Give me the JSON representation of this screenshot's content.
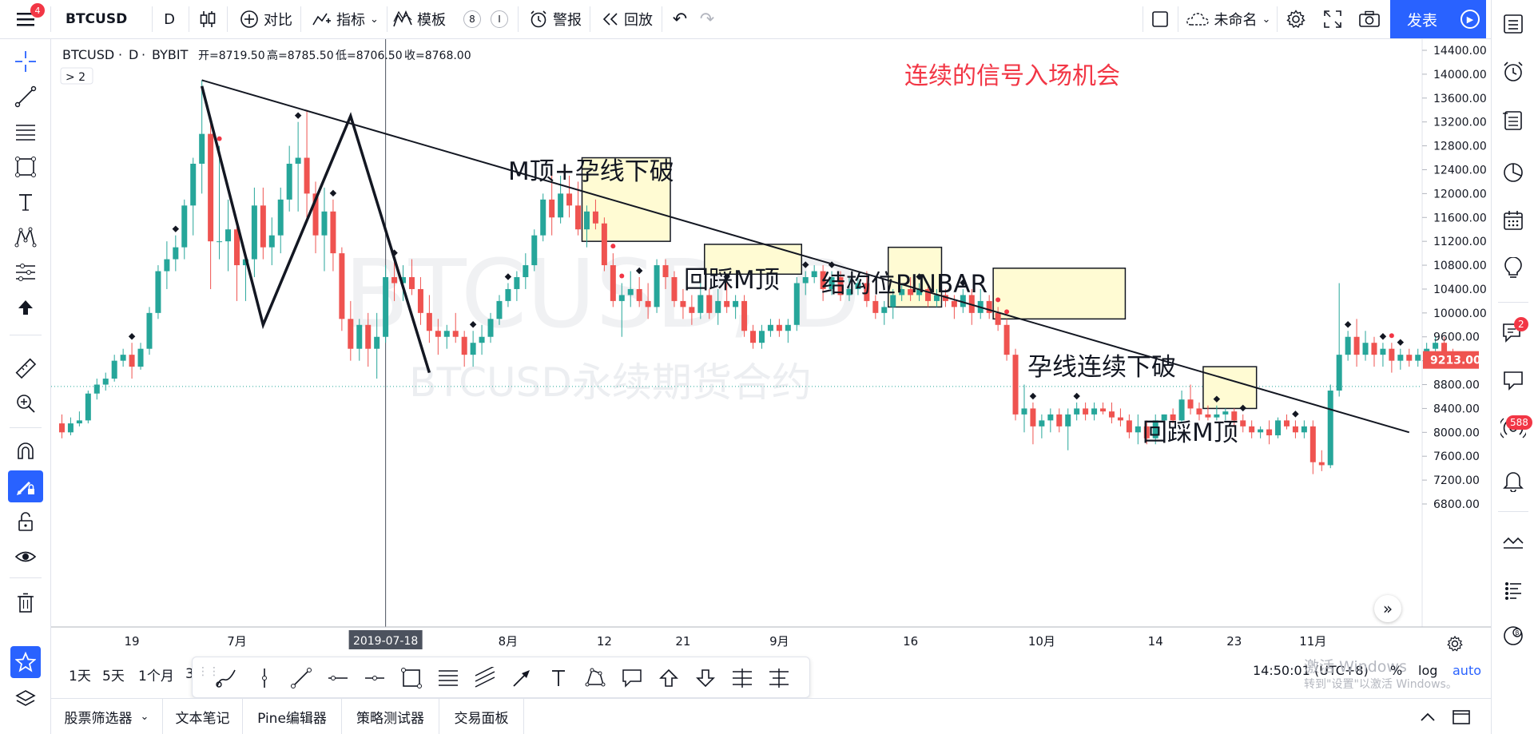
{
  "topbar": {
    "menu_badge": "4",
    "symbol": "BTCUSD",
    "interval": "D",
    "compare_label": "对比",
    "indicators_label": "指标",
    "templates_label": "模板",
    "template_chip_a": "8",
    "template_chip_b": "I",
    "alert_label": "警报",
    "replay_label": "回放",
    "layout_name": "未命名",
    "publish_label": "发表"
  },
  "legend": {
    "symbol": "BTCUSD",
    "interval": "D",
    "exchange": "BYBIT",
    "open": "开=8719.50",
    "high": "高=8785.50",
    "low": "低=8706.50",
    "close": "收=8768.00",
    "collapse": "> 2"
  },
  "watermark": {
    "line1": "BTCUSD, D",
    "line2": "BTCUSD永续期货合约"
  },
  "annotations": {
    "title": "连续的信号入场机会",
    "m_top_break": "M顶+孕线下破",
    "retest_m_top_1": "回踩M顶",
    "pinbar": "结构位PINBAR",
    "inside_bar_break": "孕线连续下破",
    "retest_m_top_2": "回踩M顶"
  },
  "chart_data": {
    "type": "candlestick",
    "title": "",
    "symbol": "BTCUSD",
    "interval": "D",
    "ylim": [
      6600,
      14800
    ],
    "y_ticks": [
      "14400.00",
      "14000.00",
      "13600.00",
      "13200.00",
      "12800.00",
      "12400.00",
      "12000.00",
      "11600.00",
      "11200.00",
      "10800.00",
      "10400.00",
      "10000.00",
      "9600.00",
      "9200.00",
      "8800.00",
      "8400.00",
      "8000.00",
      "7600.00",
      "7200.00",
      "6800.00"
    ],
    "x_ticks": [
      {
        "label": "19",
        "bar": 8
      },
      {
        "label": "7月",
        "bar": 20
      },
      {
        "label": "2019-07-18",
        "bar": 37,
        "highlight": true
      },
      {
        "label": "8月",
        "bar": 51
      },
      {
        "label": "12",
        "bar": 62
      },
      {
        "label": "21",
        "bar": 71
      },
      {
        "label": "9月",
        "bar": 82
      },
      {
        "label": "16",
        "bar": 97
      },
      {
        "label": "10月",
        "bar": 112
      },
      {
        "label": "14",
        "bar": 125
      },
      {
        "label": "23",
        "bar": 134
      },
      {
        "label": "11月",
        "bar": 143
      }
    ],
    "last_price": "9213.00",
    "dotted_price_line": 8768,
    "crosshair_bar": 37,
    "candles": [
      [
        8150,
        8300,
        7900,
        8000
      ],
      [
        8000,
        8250,
        7950,
        8150
      ],
      [
        8150,
        8350,
        8100,
        8200
      ],
      [
        8200,
        8700,
        8150,
        8650
      ],
      [
        8650,
        8900,
        8550,
        8800
      ],
      [
        8800,
        9000,
        8700,
        8900
      ],
      [
        8900,
        9300,
        8850,
        9200
      ],
      [
        9200,
        9400,
        9100,
        9300
      ],
      [
        9300,
        9500,
        8900,
        9100
      ],
      [
        9100,
        9500,
        9050,
        9400
      ],
      [
        9400,
        10100,
        9300,
        10000
      ],
      [
        10000,
        10800,
        9900,
        10700
      ],
      [
        10700,
        11200,
        10400,
        10900
      ],
      [
        10900,
        11300,
        10700,
        11100
      ],
      [
        11100,
        11900,
        10900,
        11800
      ],
      [
        11800,
        12600,
        11300,
        12500
      ],
      [
        12500,
        13900,
        12000,
        13000
      ],
      [
        13000,
        13200,
        10400,
        11200
      ],
      [
        11200,
        12800,
        10900,
        11200
      ],
      [
        11200,
        11900,
        10700,
        11400
      ],
      [
        11400,
        11500,
        10200,
        10800
      ],
      [
        10800,
        11000,
        10200,
        10900
      ],
      [
        10900,
        12100,
        10600,
        11800
      ],
      [
        11800,
        12100,
        10900,
        11100
      ],
      [
        11100,
        11600,
        10800,
        11300
      ],
      [
        11300,
        12100,
        11000,
        11900
      ],
      [
        11900,
        12800,
        11700,
        12500
      ],
      [
        12500,
        13200,
        11700,
        12600
      ],
      [
        12600,
        13400,
        11600,
        12000
      ],
      [
        12000,
        12200,
        11000,
        11300
      ],
      [
        11300,
        12100,
        10700,
        11700
      ],
      [
        11700,
        11900,
        10700,
        11000
      ],
      [
        11000,
        11100,
        9700,
        9900
      ],
      [
        9900,
        10200,
        9200,
        9400
      ],
      [
        9400,
        9900,
        9200,
        9800
      ],
      [
        9800,
        10000,
        9100,
        9400
      ],
      [
        9400,
        10000,
        8900,
        9600
      ],
      [
        9600,
        10800,
        9500,
        10600
      ],
      [
        10600,
        10900,
        10200,
        10500
      ],
      [
        10500,
        10800,
        10200,
        10600
      ],
      [
        10600,
        10900,
        10300,
        10400
      ],
      [
        10400,
        10600,
        9800,
        10000
      ],
      [
        10000,
        10300,
        9500,
        9700
      ],
      [
        9700,
        9900,
        9300,
        9600
      ],
      [
        9600,
        9800,
        9400,
        9700
      ],
      [
        9700,
        10000,
        9500,
        9600
      ],
      [
        9600,
        9700,
        9100,
        9300
      ],
      [
        9300,
        9700,
        9100,
        9500
      ],
      [
        9500,
        9800,
        9300,
        9600
      ],
      [
        9600,
        10000,
        9500,
        9900
      ],
      [
        9900,
        10300,
        9800,
        10200
      ],
      [
        10200,
        10500,
        10100,
        10400
      ],
      [
        10400,
        10700,
        10200,
        10600
      ],
      [
        10600,
        11000,
        10400,
        10800
      ],
      [
        10800,
        11400,
        10700,
        11300
      ],
      [
        11300,
        12000,
        11200,
        11900
      ],
      [
        11900,
        12400,
        11300,
        11600
      ],
      [
        11600,
        12300,
        11500,
        12000
      ],
      [
        12000,
        12300,
        11600,
        11800
      ],
      [
        11800,
        12200,
        11300,
        11400
      ],
      [
        11400,
        11800,
        11100,
        11700
      ],
      [
        11700,
        11900,
        11400,
        11500
      ],
      [
        11500,
        11600,
        10700,
        10800
      ],
      [
        10800,
        11000,
        10100,
        10200
      ],
      [
        10200,
        10500,
        9600,
        10300
      ],
      [
        10300,
        10700,
        10100,
        10400
      ],
      [
        10400,
        10600,
        10100,
        10200
      ],
      [
        10200,
        10500,
        9900,
        10100
      ],
      [
        10100,
        10900,
        10000,
        10800
      ],
      [
        10800,
        10900,
        10400,
        10600
      ],
      [
        10600,
        10700,
        10100,
        10200
      ],
      [
        10200,
        10400,
        9900,
        10100
      ],
      [
        10100,
        10300,
        9800,
        10000
      ],
      [
        10000,
        10500,
        9900,
        10300
      ],
      [
        10300,
        10400,
        9900,
        10000
      ],
      [
        10000,
        10400,
        9800,
        10200
      ],
      [
        10200,
        10500,
        10000,
        10100
      ],
      [
        10100,
        10300,
        9900,
        10200
      ],
      [
        10200,
        10300,
        9600,
        9700
      ],
      [
        9700,
        9800,
        9400,
        9500
      ],
      [
        9500,
        9800,
        9400,
        9700
      ],
      [
        9700,
        9900,
        9600,
        9800
      ],
      [
        9800,
        9900,
        9600,
        9700
      ],
      [
        9700,
        9900,
        9500,
        9800
      ],
      [
        9800,
        10600,
        9700,
        10500
      ],
      [
        10500,
        10700,
        10300,
        10600
      ],
      [
        10600,
        10800,
        10500,
        10700
      ],
      [
        10700,
        10800,
        10200,
        10400
      ],
      [
        10400,
        10700,
        10300,
        10600
      ],
      [
        10600,
        10700,
        10200,
        10300
      ],
      [
        10300,
        10600,
        10200,
        10400
      ],
      [
        10400,
        10600,
        10300,
        10500
      ],
      [
        10500,
        10700,
        10100,
        10200
      ],
      [
        10200,
        10300,
        9900,
        10000
      ],
      [
        10000,
        10200,
        9800,
        10100
      ],
      [
        10100,
        10400,
        9900,
        10300
      ],
      [
        10300,
        10500,
        10200,
        10400
      ],
      [
        10400,
        10600,
        10200,
        10300
      ],
      [
        10300,
        10500,
        10200,
        10400
      ],
      [
        10400,
        10500,
        10100,
        10200
      ],
      [
        10200,
        10400,
        10100,
        10300
      ],
      [
        10300,
        10400,
        10100,
        10200
      ],
      [
        10200,
        10300,
        9900,
        10100
      ],
      [
        10100,
        10400,
        10000,
        10300
      ],
      [
        10300,
        10400,
        9800,
        10000
      ],
      [
        10000,
        10400,
        9900,
        10200
      ],
      [
        10200,
        10300,
        9900,
        10000
      ],
      [
        10000,
        10100,
        9700,
        9800
      ],
      [
        9800,
        9900,
        9200,
        9300
      ],
      [
        9300,
        9400,
        8200,
        8300
      ],
      [
        8300,
        8800,
        8000,
        8400
      ],
      [
        8400,
        8500,
        7800,
        8100
      ],
      [
        8100,
        8300,
        7900,
        8200
      ],
      [
        8200,
        8400,
        8000,
        8300
      ],
      [
        8300,
        8400,
        8000,
        8100
      ],
      [
        8100,
        8400,
        7700,
        8300
      ],
      [
        8300,
        8500,
        8200,
        8400
      ],
      [
        8400,
        8500,
        8200,
        8300
      ],
      [
        8300,
        8500,
        8200,
        8400
      ],
      [
        8400,
        8500,
        8300,
        8350
      ],
      [
        8350,
        8500,
        8150,
        8250
      ],
      [
        8250,
        8400,
        8100,
        8200
      ],
      [
        8200,
        8300,
        7900,
        8000
      ],
      [
        8000,
        8300,
        7800,
        8100
      ],
      [
        8100,
        8200,
        7800,
        7900
      ],
      [
        7900,
        8300,
        7800,
        8200
      ],
      [
        8200,
        8300,
        8100,
        8300
      ],
      [
        8300,
        8400,
        8150,
        8200
      ],
      [
        8200,
        8700,
        8150,
        8550
      ],
      [
        8550,
        8800,
        8300,
        8400
      ],
      [
        8400,
        8500,
        8200,
        8300
      ],
      [
        8300,
        8450,
        8200,
        8250
      ],
      [
        8250,
        8450,
        8200,
        8300
      ],
      [
        8300,
        8400,
        8200,
        8350
      ],
      [
        8350,
        8400,
        8100,
        8200
      ],
      [
        8200,
        8300,
        8000,
        8100
      ],
      [
        8100,
        8200,
        7900,
        8000
      ],
      [
        8000,
        8100,
        7900,
        8050
      ],
      [
        8050,
        8200,
        7800,
        7950
      ],
      [
        7950,
        8250,
        7900,
        8200
      ],
      [
        8200,
        8300,
        8050,
        8100
      ],
      [
        8100,
        8200,
        7900,
        8000
      ],
      [
        8000,
        8200,
        7900,
        8100
      ],
      [
        8100,
        8200,
        7300,
        7500
      ],
      [
        7500,
        7700,
        7350,
        7450
      ],
      [
        7450,
        8800,
        7400,
        8700
      ],
      [
        8700,
        10500,
        8600,
        9300
      ],
      [
        9300,
        9700,
        9200,
        9600
      ],
      [
        9600,
        9900,
        9100,
        9300
      ],
      [
        9300,
        9700,
        9200,
        9500
      ],
      [
        9500,
        9600,
        9100,
        9300
      ],
      [
        9300,
        9500,
        9100,
        9400
      ],
      [
        9400,
        9500,
        9000,
        9200
      ],
      [
        9200,
        9400,
        9050,
        9300
      ],
      [
        9300,
        9400,
        9100,
        9200
      ],
      [
        9200,
        9400,
        9100,
        9300
      ],
      [
        9300,
        9500,
        9100,
        9400
      ],
      [
        9400,
        9600,
        9200,
        9500
      ],
      [
        9500,
        9600,
        9200,
        9300
      ],
      [
        9300,
        9400,
        9100,
        9250
      ]
    ],
    "trendlines": [
      {
        "from": [
          16,
          13900
        ],
        "to": [
          154,
          8000
        ]
      }
    ],
    "m_pattern_zigzag": [
      [
        16,
        13800
      ],
      [
        23,
        9800
      ],
      [
        33,
        13300
      ],
      [
        42,
        9000
      ]
    ],
    "boxes": [
      {
        "from_bar": 60,
        "to_bar": 69,
        "low": 11200,
        "high": 12600
      },
      {
        "from_bar": 74,
        "to_bar": 84,
        "low": 10650,
        "high": 11150
      },
      {
        "from_bar": 95,
        "to_bar": 100,
        "low": 10100,
        "high": 11100
      },
      {
        "from_bar": 107,
        "to_bar": 121,
        "low": 9900,
        "high": 10750
      },
      {
        "from_bar": 131,
        "to_bar": 136,
        "low": 8400,
        "high": 9100
      }
    ]
  },
  "bottom": {
    "tabs": [
      "股票筛选器",
      "文本笔记",
      "Pine编辑器",
      "策略测试器",
      "交易面板"
    ],
    "timeframes": [
      "1天",
      "5天",
      "1个月",
      "3"
    ],
    "time": "14:50:01 (UTC+8)",
    "pct": "%",
    "log": "log",
    "auto": "auto",
    "win_line1": "激活 Windows",
    "win_line2": "转到\"设置\"以激活 Windows。"
  },
  "right_badges": {
    "chat": "2",
    "stream": "588"
  },
  "colors": {
    "up": "#26a69a",
    "down": "#ef5350",
    "accent": "#2962ff",
    "annotation_red": "#f23645",
    "box_fill": "#fffbd3"
  }
}
